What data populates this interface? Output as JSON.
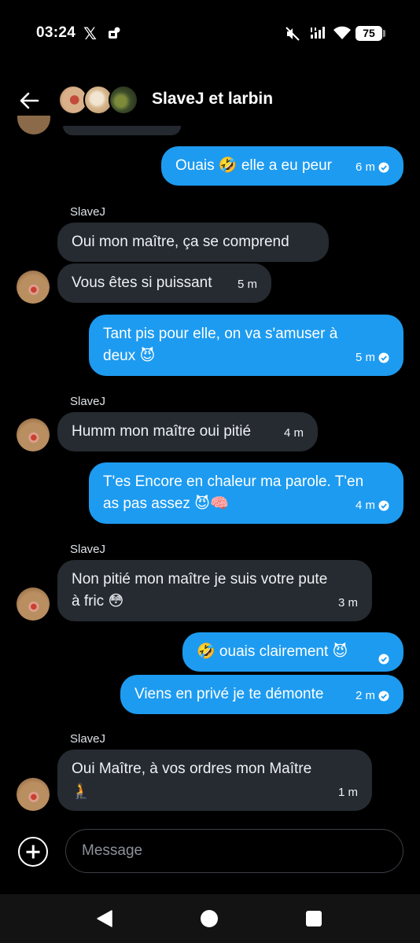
{
  "status": {
    "time": "03:24",
    "x_logo": "𝕏",
    "battery": "75",
    "icons": [
      "x-logo-icon",
      "notification-icon",
      "mute-icon",
      "signal-icon",
      "wifi-icon",
      "battery-icon"
    ]
  },
  "header": {
    "title": "SlaveJ et larbin",
    "back_icon": "arrow-left-icon"
  },
  "messages": [
    {
      "dir": "out",
      "text": "Ouais 🤣 elle a eu peur",
      "time": "6 m",
      "read": true
    },
    {
      "dir": "in",
      "sender": "SlaveJ",
      "text": "Oui mon maître, ça se comprend"
    },
    {
      "dir": "in",
      "text": "Vous êtes si puissant",
      "time": "5 m"
    },
    {
      "dir": "out",
      "text": "Tant pis pour elle, on va s'amuser à",
      "text2": "deux 😈",
      "time": "5 m",
      "read": true
    },
    {
      "dir": "in",
      "sender": "SlaveJ",
      "text": "Humm mon maître oui pitié",
      "time": "4 m"
    },
    {
      "dir": "out",
      "text": "T'es Encore en chaleur ma parole. T'en",
      "text2": "as pas assez 😈🧠",
      "time": "4 m",
      "read": true
    },
    {
      "dir": "in",
      "sender": "SlaveJ",
      "text": "Non pitié mon maître je suis votre pute",
      "text2": "à fric 😳",
      "time": "3 m"
    },
    {
      "dir": "out",
      "text": "🤣 ouais clairement 😈",
      "read": true
    },
    {
      "dir": "out",
      "text": "Viens en privé je te démonte",
      "time": "2 m",
      "read": true
    },
    {
      "dir": "in",
      "sender": "SlaveJ",
      "text": "Oui Maître, à vos ordres mon Maître",
      "text2": "🧎",
      "time": "1 m"
    }
  ],
  "composer": {
    "placeholder": "Message",
    "add_icon": "plus-circle-icon"
  },
  "navbar": {
    "icons": [
      "nav-back-icon",
      "nav-home-icon",
      "nav-recents-icon"
    ]
  },
  "colors": {
    "outgoing_bubble": "#1d9bf0",
    "incoming_bubble": "#262b31",
    "background": "#000000"
  }
}
